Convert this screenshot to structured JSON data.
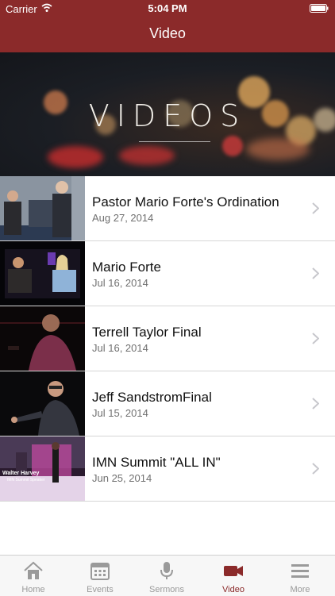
{
  "status_bar": {
    "carrier": "Carrier",
    "time": "5:04 PM"
  },
  "nav": {
    "title": "Video"
  },
  "hero": {
    "title": "VIDEOS"
  },
  "videos": [
    {
      "title": "Pastor Mario Forte's Ordination",
      "date": "Aug 27, 2014"
    },
    {
      "title": "Mario Forte",
      "date": "Jul 16, 2014"
    },
    {
      "title": "Terrell Taylor Final",
      "date": "Jul 16, 2014"
    },
    {
      "title": "Jeff SandstromFinal",
      "date": "Jul 15, 2014"
    },
    {
      "title": "IMN Summit \"ALL IN\"",
      "date": "Jun 25, 2014",
      "thumb_caption": "Walter Harvey",
      "thumb_subcaption": "IMN Summit Speaker"
    }
  ],
  "tabs": [
    {
      "label": "Home",
      "icon": "house-icon"
    },
    {
      "label": "Events",
      "icon": "calendar-icon"
    },
    {
      "label": "Sermons",
      "icon": "microphone-icon"
    },
    {
      "label": "Video",
      "icon": "video-camera-icon",
      "active": true
    },
    {
      "label": "More",
      "icon": "menu-icon"
    }
  ],
  "colors": {
    "brand": "#8b2a2a",
    "inactive": "#9a9a9a"
  }
}
